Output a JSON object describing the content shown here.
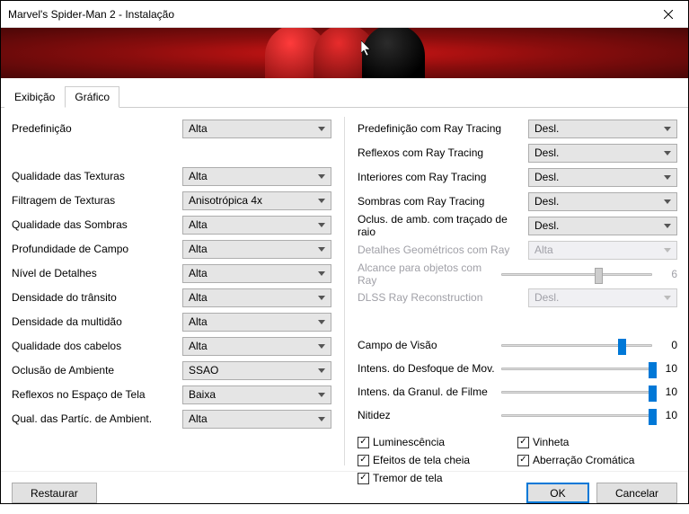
{
  "window": {
    "title": "Marvel's Spider-Man 2 - Instalação"
  },
  "tabs": {
    "display": "Exibição",
    "graphics": "Gráfico"
  },
  "left": {
    "preset": {
      "label": "Predefinição",
      "value": "Alta"
    },
    "texQuality": {
      "label": "Qualidade das Texturas",
      "value": "Alta"
    },
    "texFilter": {
      "label": "Filtragem de Texturas",
      "value": "Anisotrópica 4x"
    },
    "shadowQuality": {
      "label": "Qualidade das Sombras",
      "value": "Alta"
    },
    "dof": {
      "label": "Profundidade de Campo",
      "value": "Alta"
    },
    "lod": {
      "label": "Nível de Detalhes",
      "value": "Alta"
    },
    "traffic": {
      "label": "Densidade do trânsito",
      "value": "Alta"
    },
    "crowd": {
      "label": "Densidade da multidão",
      "value": "Alta"
    },
    "hair": {
      "label": "Qualidade dos cabelos",
      "value": "Alta"
    },
    "ao": {
      "label": "Oclusão de Ambiente",
      "value": "SSAO"
    },
    "ssr": {
      "label": "Reflexos no Espaço de Tela",
      "value": "Baixa"
    },
    "particles": {
      "label": "Qual. das Partíc. de Ambient.",
      "value": "Alta"
    }
  },
  "right": {
    "rtPreset": {
      "label": "Predefinição com Ray Tracing",
      "value": "Desl."
    },
    "rtReflections": {
      "label": "Reflexos com Ray Tracing",
      "value": "Desl."
    },
    "rtInteriors": {
      "label": "Interiores com Ray Tracing",
      "value": "Desl."
    },
    "rtShadows": {
      "label": "Sombras com Ray Tracing",
      "value": "Desl."
    },
    "rtAO": {
      "label": "Oclus. de amb. com traçado de raio",
      "value": "Desl."
    },
    "rtGeoDetail": {
      "label": "Detalhes Geométricos com Ray",
      "value": "Alta"
    },
    "rtRange": {
      "label": "Alcance para objetos com Ray",
      "value": "6",
      "pos": 62
    },
    "dlssRR": {
      "label": "DLSS Ray Reconstruction",
      "value": "Desl."
    },
    "fov": {
      "label": "Campo de Visão",
      "value": "0",
      "pos": 78
    },
    "motionBlur": {
      "label": "Intens. do Desfoque de Mov.",
      "value": "10",
      "pos": 98
    },
    "filmGrain": {
      "label": "Intens. da Granul. de Filme",
      "value": "10",
      "pos": 98
    },
    "sharpness": {
      "label": "Nitidez",
      "value": "10",
      "pos": 98
    }
  },
  "checks": {
    "bloom": "Luminescência",
    "fullscreen": "Efeitos de tela cheia",
    "screenShake": "Tremor de tela",
    "vignette": "Vinheta",
    "chromAb": "Aberração Cromática"
  },
  "footer": {
    "restore": "Restaurar",
    "ok": "OK",
    "cancel": "Cancelar"
  }
}
